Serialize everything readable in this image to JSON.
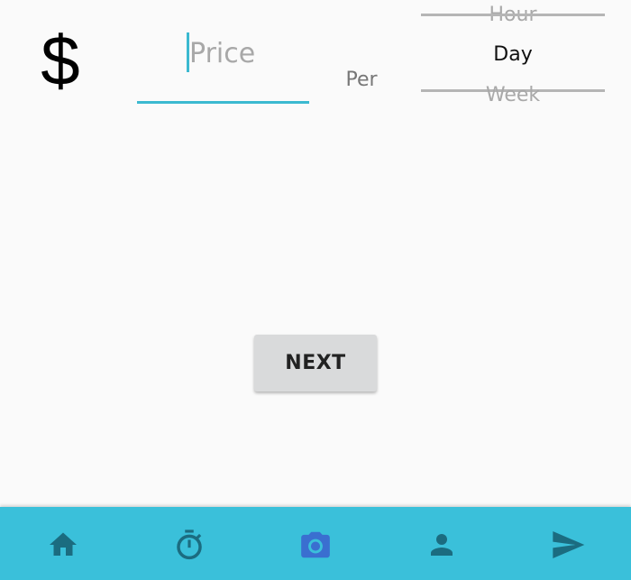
{
  "price": {
    "currency_symbol": "$",
    "placeholder": "Price",
    "value": ""
  },
  "per_label": "Per",
  "period_picker": {
    "above": "Hour",
    "selected": "Day",
    "below": "Week"
  },
  "next_button": {
    "label": "NEXT"
  },
  "bottom_nav": {
    "items": [
      {
        "icon": "home-icon",
        "active": false
      },
      {
        "icon": "timer-icon",
        "active": false
      },
      {
        "icon": "camera-icon",
        "active": true
      },
      {
        "icon": "person-icon",
        "active": false
      },
      {
        "icon": "send-icon",
        "active": false
      }
    ]
  },
  "colors": {
    "accent": "#3bb9d0",
    "nav_background": "#3ac0da",
    "nav_icon": "#1b6c80",
    "nav_icon_active": "#3a6fd0",
    "button_background": "#d9dadb",
    "background": "#fafafa"
  }
}
